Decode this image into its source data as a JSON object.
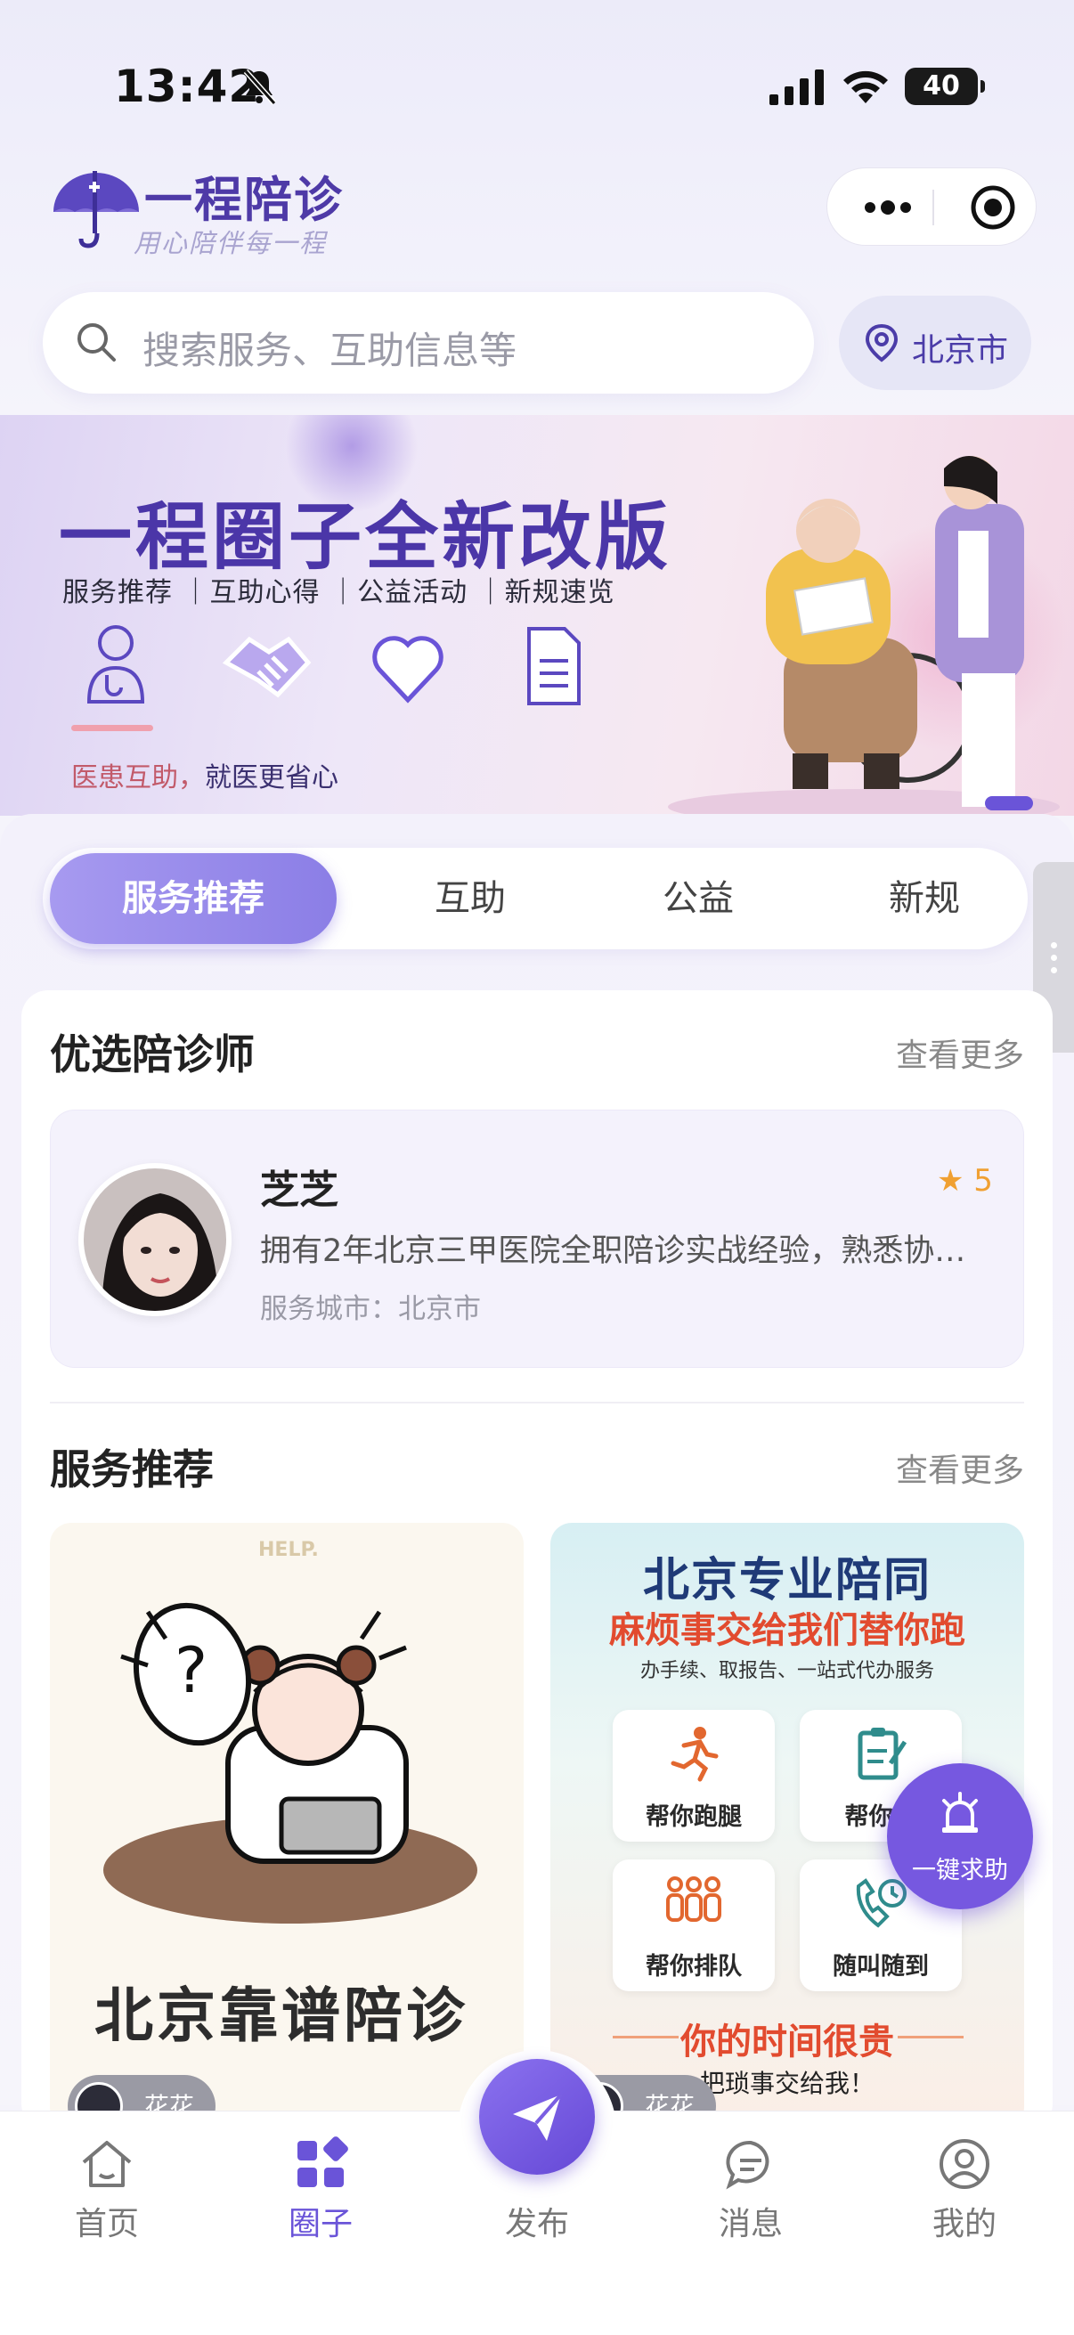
{
  "status_bar": {
    "time": "13:42",
    "battery": "40"
  },
  "brand": {
    "name": "一程陪诊",
    "slogan": "用心陪伴每一程"
  },
  "search": {
    "placeholder": "搜索服务、互助信息等"
  },
  "location": {
    "city": "北京市"
  },
  "banner": {
    "title": "一程圈子全新改版",
    "subtitle": "服务推荐 ｜互助心得 ｜公益活动 ｜新规速览",
    "tagline_highlight": "医患互助，",
    "tagline_rest": "就医更省心"
  },
  "tabs": [
    {
      "label": "服务推荐",
      "active": true
    },
    {
      "label": "互助",
      "active": false
    },
    {
      "label": "公益",
      "active": false
    },
    {
      "label": "新规",
      "active": false
    }
  ],
  "escort_section": {
    "title": "优选陪诊师",
    "more": "查看更多",
    "escort": {
      "name": "芝芝",
      "rating": "5",
      "description": "拥有2年北京三甲医院全职陪诊实战经验，熟悉协…",
      "city": "服务城市：北京市"
    }
  },
  "service_section": {
    "title": "服务推荐",
    "more": "查看更多",
    "card1": {
      "help_text": "HELP.",
      "title": "北京靠谱陪诊",
      "author": "花花"
    },
    "card2": {
      "title": "北京专业陪同",
      "subtitle": "麻烦事交给我们替你跑",
      "desc": "办手续、取报告、一站式代办服务",
      "items": [
        "帮你跑腿",
        "帮你代",
        "帮你排队",
        "随叫随到"
      ],
      "footer_title": "你的时间很贵",
      "footer_sub": "把琐事交给我！",
      "author": "花花"
    }
  },
  "sos": {
    "label": "一键求助"
  },
  "tabbar": [
    {
      "label": "首页",
      "icon": "home-icon"
    },
    {
      "label": "圈子",
      "icon": "circle-grid-icon",
      "active": true
    },
    {
      "label": "发布",
      "icon": "paper-plane-icon"
    },
    {
      "label": "消息",
      "icon": "message-icon"
    },
    {
      "label": "我的",
      "icon": "user-icon"
    }
  ],
  "colors": {
    "accent": "#6a54d8",
    "brand": "#4e3aa7"
  }
}
